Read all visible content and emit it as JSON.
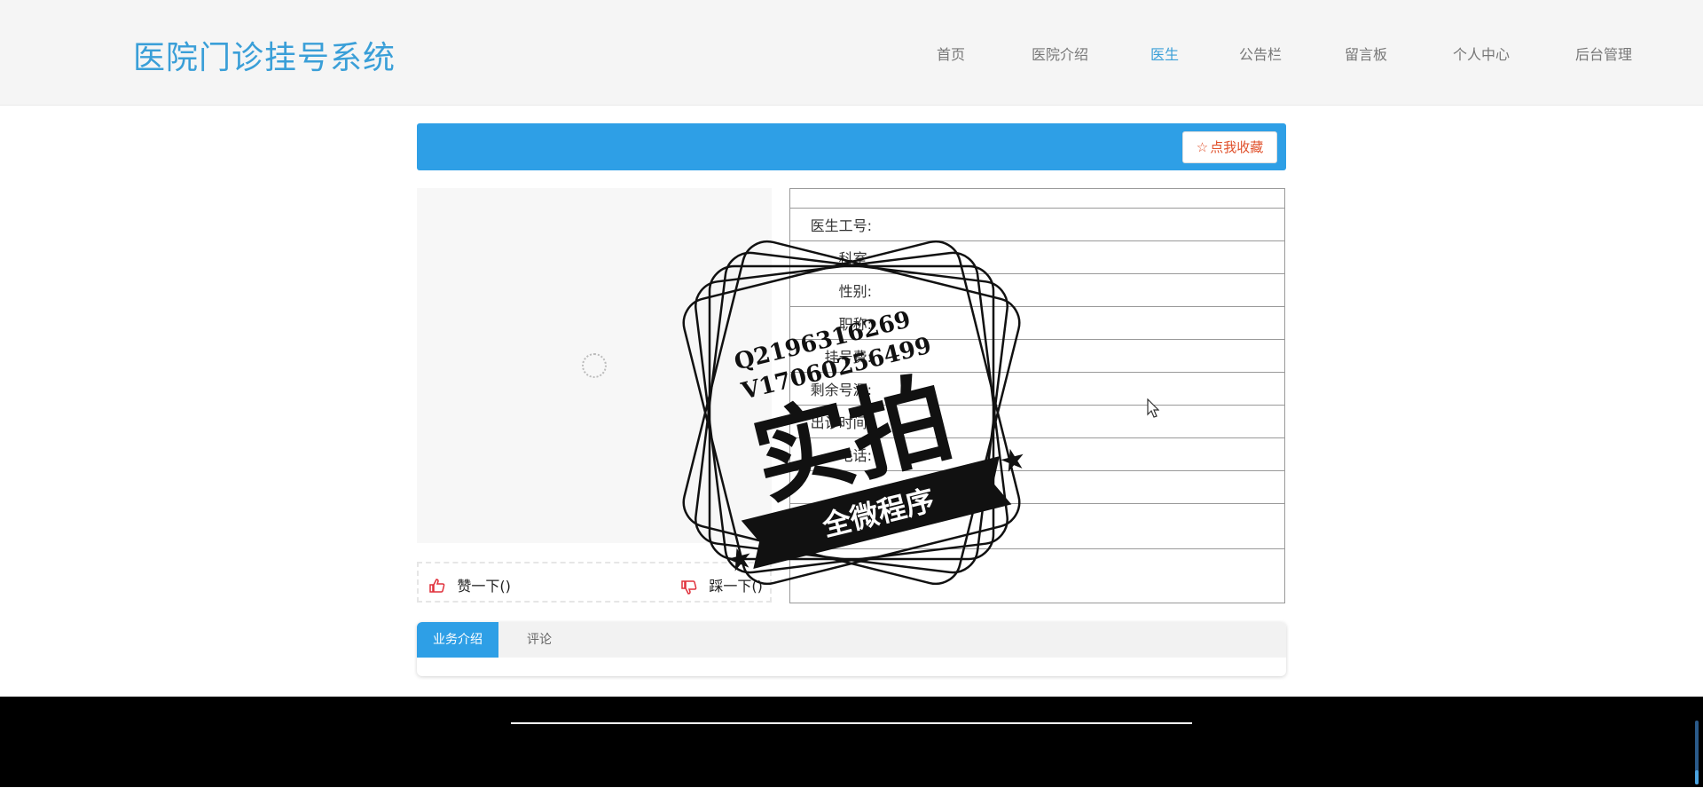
{
  "header": {
    "site_title": "医院门诊挂号系统",
    "nav": [
      {
        "label": "首页"
      },
      {
        "label": "医院介绍"
      },
      {
        "label": "医生",
        "active": true
      },
      {
        "label": "公告栏"
      },
      {
        "label": "留言板"
      },
      {
        "label": "个人中心"
      },
      {
        "label": "后台管理"
      }
    ]
  },
  "banner": {
    "favorite_label": "点我收藏",
    "favorite_icon": "star-outline-icon"
  },
  "detail": {
    "fields": [
      {
        "label": ""
      },
      {
        "label": "医生工号:"
      },
      {
        "label": "科室:"
      },
      {
        "label": "性别:"
      },
      {
        "label": "职称:"
      },
      {
        "label": "挂号费:"
      },
      {
        "label": "剩余号源:"
      },
      {
        "label": "出诊时间:"
      },
      {
        "label": "电话:"
      },
      {
        "label": ""
      },
      {
        "label": ""
      },
      {
        "label": ""
      }
    ]
  },
  "votes": {
    "like_label": "赞一下()",
    "dislike_label": "踩一下()"
  },
  "tabs": [
    {
      "label": "业务介绍",
      "active": true
    },
    {
      "label": "评论",
      "active": false
    }
  ],
  "watermark": {
    "line1": "Q2196316269",
    "line2": "V17060256499",
    "main": "实拍",
    "ribbon": "全微程序"
  },
  "colors": {
    "primary": "#2e9fe6",
    "title": "#3a9fd8",
    "favorite_text": "#e0502b",
    "thumb": "#e0303b"
  }
}
